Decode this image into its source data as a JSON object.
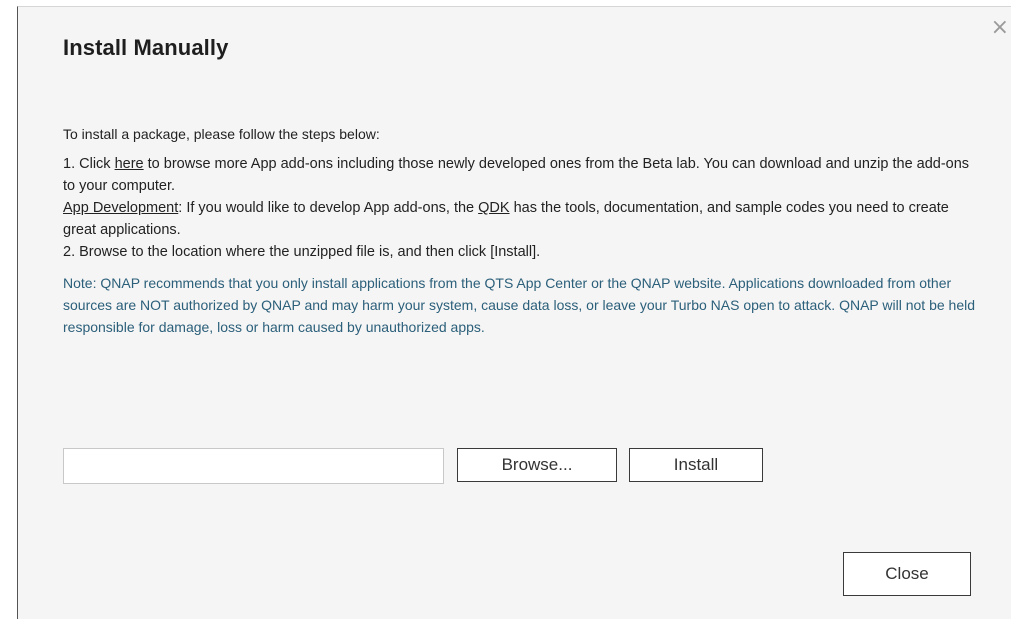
{
  "dialog": {
    "title": "Install Manually",
    "close_icon": "×"
  },
  "instructions": {
    "intro": "To install a package, please follow the steps below:",
    "step1_prefix": "1. Click ",
    "step1_link": "here",
    "step1_suffix": " to browse more App add-ons including those newly developed ones from the Beta lab. You can download and unzip the add-ons to your computer.",
    "app_dev_link": "App Development",
    "app_dev_mid": ": If you would like to develop App add-ons, the ",
    "qdk_link": "QDK",
    "app_dev_suffix": " has the tools, documentation, and sample codes you need to create great applications.",
    "step2": "2. Browse to the location where the unzipped file is, and then click [Install]."
  },
  "note": {
    "text": "Note: QNAP recommends that you only install applications from the QTS App Center or the QNAP website. Applications downloaded from other sources are NOT authorized by QNAP and may harm your system, cause data loss, or leave your Turbo NAS open to attack. QNAP will not be held responsible for damage, loss or harm caused by unauthorized apps.",
    "color": "#2b5f7a"
  },
  "upload": {
    "file_value": "",
    "browse_label": "Browse...",
    "install_label": "Install"
  },
  "footer": {
    "close_label": "Close"
  }
}
